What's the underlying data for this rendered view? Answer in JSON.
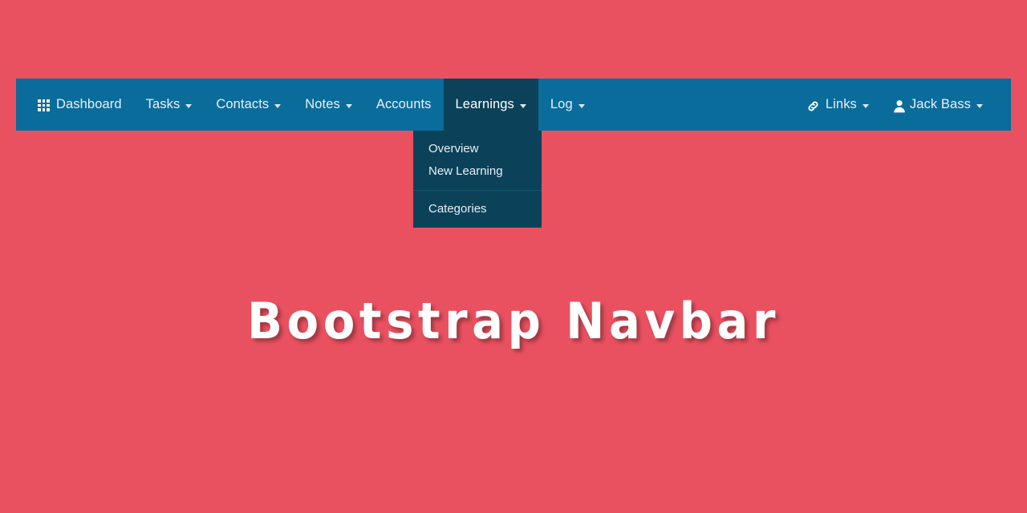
{
  "page": {
    "background_color": "#ea5160",
    "hero_title": "Bootstrap Navbar"
  },
  "navbar": {
    "background_color": "#0a6c9b",
    "active_background_color": "#0b4259",
    "text_color": "#e9f1f6",
    "left_items": [
      {
        "label": "Dashboard",
        "icon": "grid-icon",
        "has_caret": false,
        "active": false
      },
      {
        "label": "Tasks",
        "icon": null,
        "has_caret": true,
        "active": false
      },
      {
        "label": "Contacts",
        "icon": null,
        "has_caret": true,
        "active": false
      },
      {
        "label": "Notes",
        "icon": null,
        "has_caret": true,
        "active": false
      },
      {
        "label": "Accounts",
        "icon": null,
        "has_caret": false,
        "active": false
      },
      {
        "label": "Learnings",
        "icon": null,
        "has_caret": true,
        "active": true
      },
      {
        "label": "Log",
        "icon": null,
        "has_caret": true,
        "active": false
      }
    ],
    "right_items": [
      {
        "label": "Links",
        "icon": "link-icon",
        "has_caret": true
      },
      {
        "label": "Jack Bass",
        "icon": "user-icon",
        "has_caret": true
      }
    ]
  },
  "dropdown": {
    "owner": "Learnings",
    "background_color": "#0b4259",
    "items": [
      {
        "label": "Overview"
      },
      {
        "label": "New Learning"
      }
    ],
    "items_after_divider": [
      {
        "label": "Categories"
      }
    ]
  }
}
